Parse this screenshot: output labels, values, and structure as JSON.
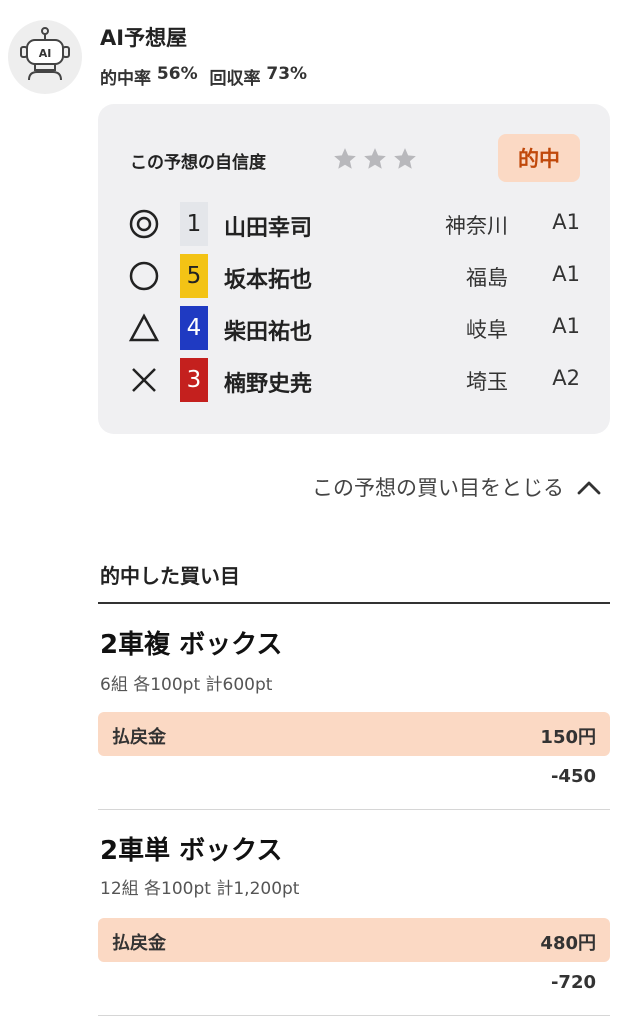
{
  "header": {
    "name": "AI予想屋",
    "hit_rate_label": "的中率",
    "hit_rate_value": "56%",
    "return_rate_label": "回収率",
    "return_rate_value": "73%",
    "avatar_text": "AI"
  },
  "card": {
    "confidence_label": "この予想の自信度",
    "confidence_stars": 0,
    "confidence_stars_max": 3,
    "badge": "的中",
    "rows": [
      {
        "mark": "double-circle",
        "num": "1",
        "num_bg": "#e4e6ea",
        "num_fg": "#222222",
        "name": "山田幸司",
        "pref": "神奈川",
        "cls": "A1"
      },
      {
        "mark": "circle",
        "num": "5",
        "num_bg": "#f3c315",
        "num_fg": "#222222",
        "name": "坂本拓也",
        "pref": "福島",
        "cls": "A1"
      },
      {
        "mark": "triangle",
        "num": "4",
        "num_bg": "#1f3ac2",
        "num_fg": "#ffffff",
        "name": "柴田祐也",
        "pref": "岐阜",
        "cls": "A1"
      },
      {
        "mark": "cross",
        "num": "3",
        "num_bg": "#c4201e",
        "num_fg": "#ffffff",
        "name": "楠野史尭",
        "pref": "埼玉",
        "cls": "A2"
      }
    ]
  },
  "toggle": {
    "label": "この予想の買い目をとじる"
  },
  "hit_section": {
    "title": "的中した買い目",
    "bets": [
      {
        "title": "2車複 ボックス",
        "sub": "6組 各100pt 計600pt",
        "payout_label": "払戻金",
        "payout_value": "150円",
        "net": "-450"
      },
      {
        "title": "2車単 ボックス",
        "sub": "12組 各100pt 計1,200pt",
        "payout_label": "払戻金",
        "payout_value": "480円",
        "net": "-720"
      }
    ]
  },
  "colors": {
    "card_bg": "#f0f0f2",
    "badge_bg": "#fbd9c4",
    "badge_fg": "#c0480a",
    "payout_bg": "#fbd9c4"
  }
}
